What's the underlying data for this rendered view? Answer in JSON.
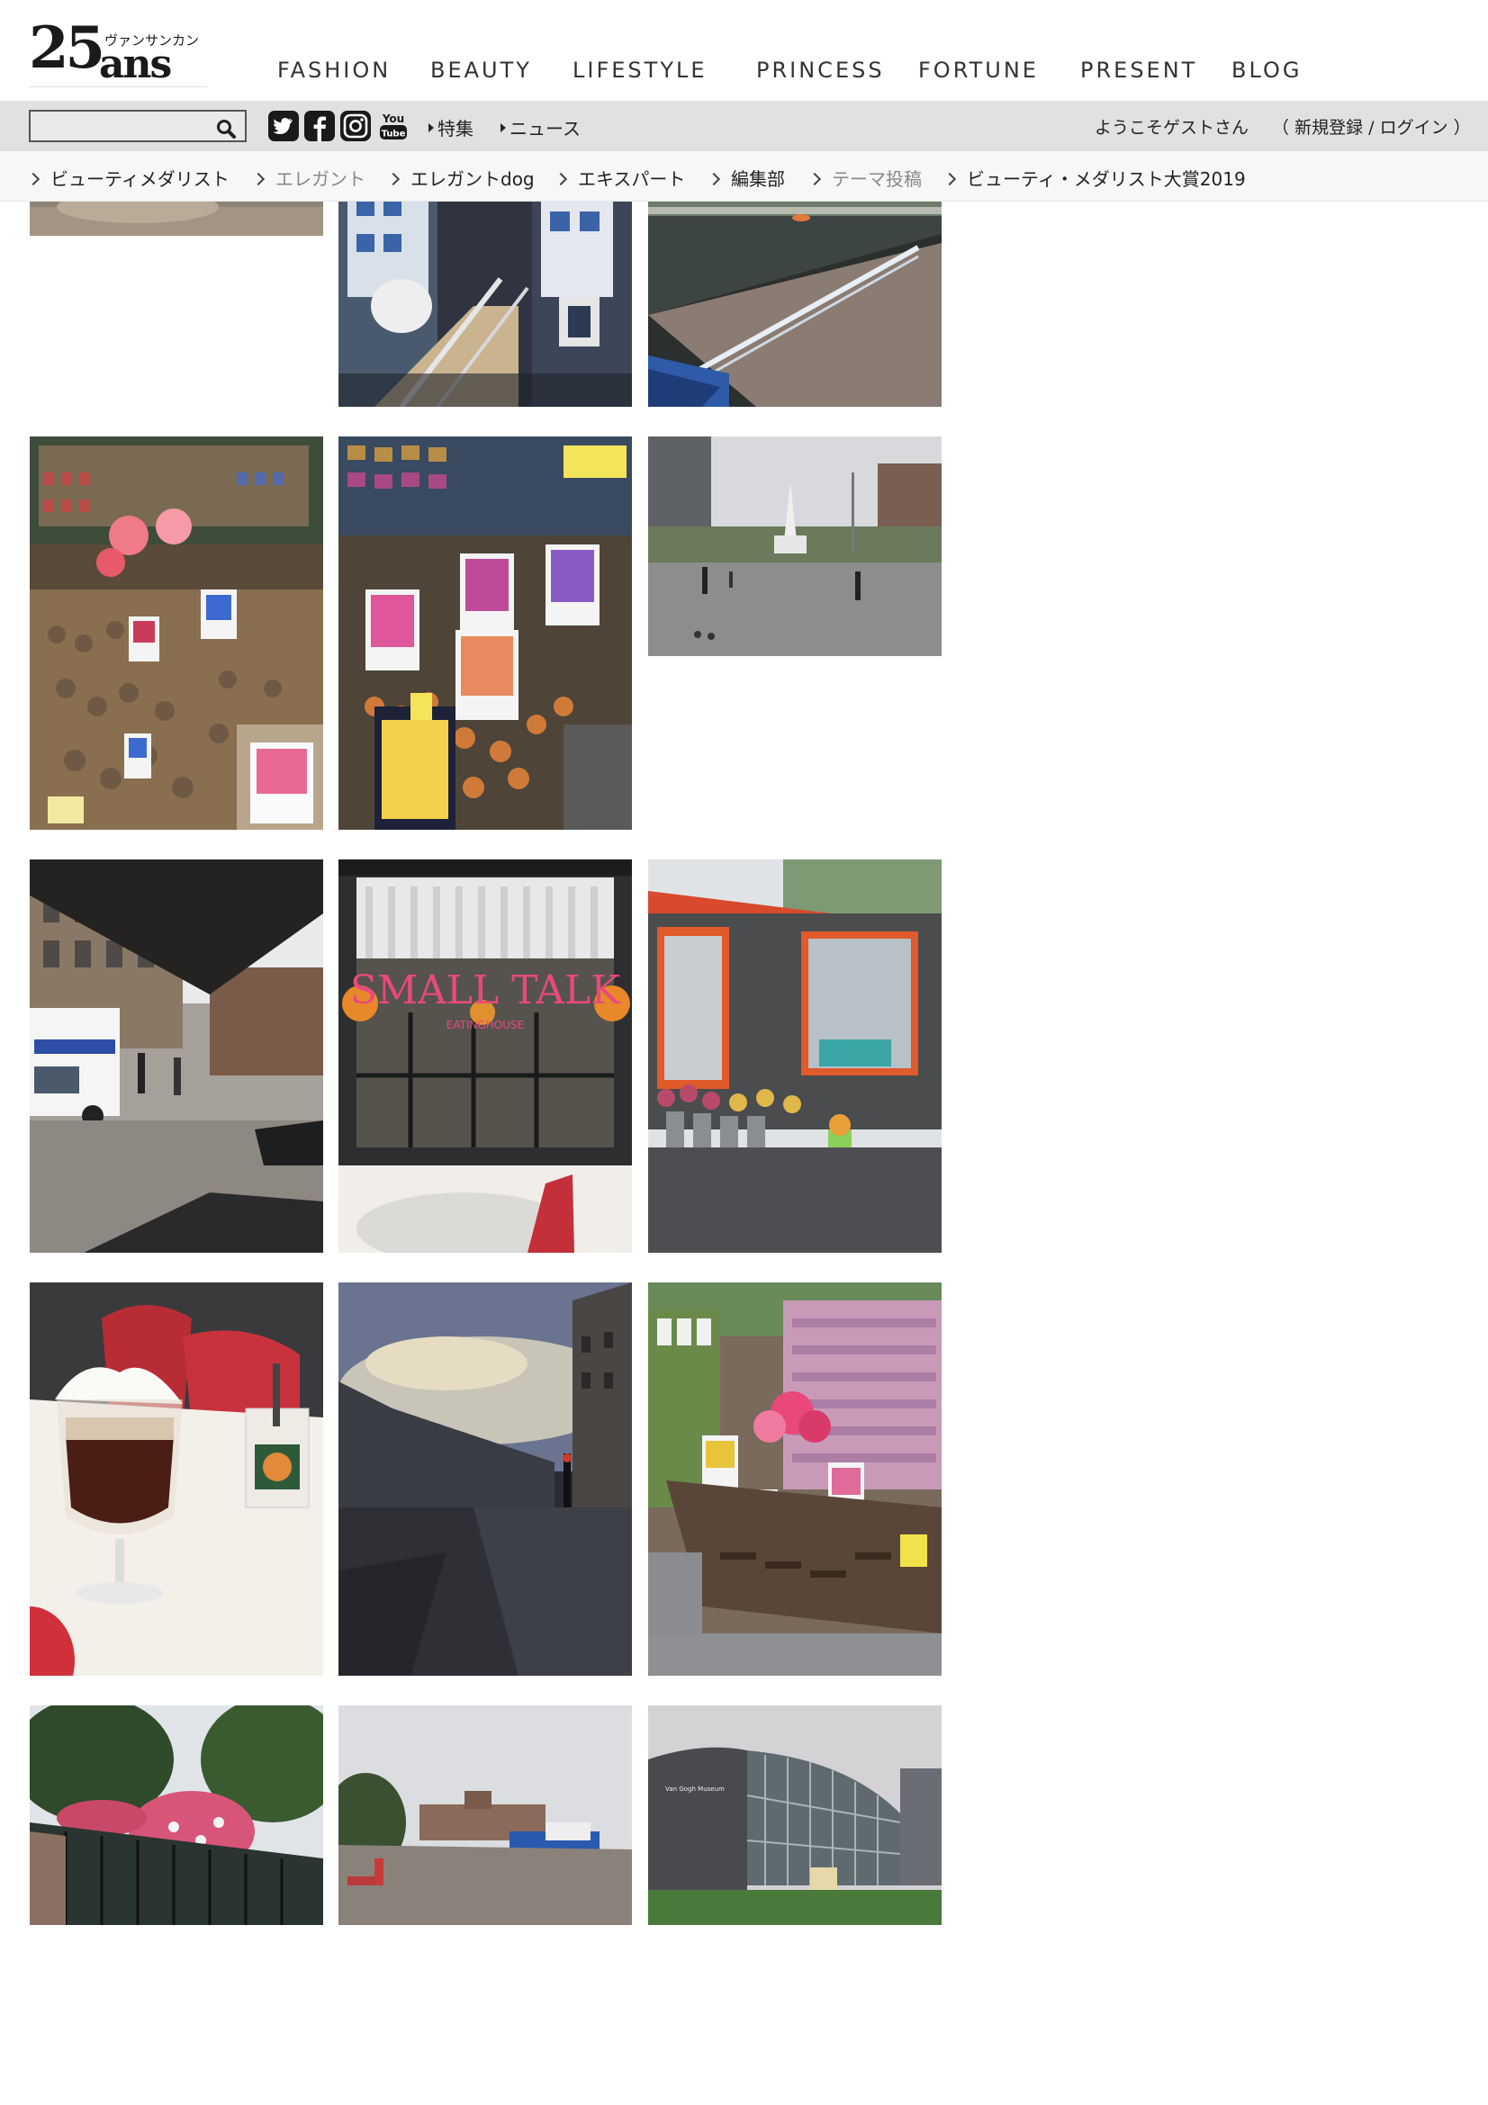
{
  "logo": {
    "number": "25",
    "word": "ans",
    "kana": "ヴァンサンカン"
  },
  "nav": [
    "FASHION",
    "BEAUTY",
    "LIFESTYLE",
    "PRINCESS",
    "FORTUNE",
    "PRESENT",
    "BLOG"
  ],
  "search": {
    "placeholder": "",
    "value": ""
  },
  "social": [
    "twitter-icon",
    "facebook-icon",
    "instagram-icon",
    "youtube-icon"
  ],
  "youtube_label": {
    "top": "You",
    "bottom": "Tube"
  },
  "bar_links": [
    "特集",
    "ニュース"
  ],
  "user": {
    "welcome": "ようこそゲストさん",
    "open": "（",
    "register": "新規登録",
    "sep": "/",
    "login": "ログイン",
    "close": "）"
  },
  "categories": [
    {
      "label": "ビューティメダリスト",
      "muted": false
    },
    {
      "label": "エレガント",
      "muted": true
    },
    {
      "label": "エレガントdog",
      "muted": false
    },
    {
      "label": "エキスパート",
      "muted": false
    },
    {
      "label": "編集部",
      "muted": false
    },
    {
      "label": "テーマ投稿",
      "muted": true
    },
    {
      "label": "ビューティ・メダリスト大賞2019",
      "muted": false
    }
  ],
  "photos": [
    {
      "subject": "top-left-photo-partial"
    },
    {
      "subject": "staircase-delft-shop"
    },
    {
      "subject": "canal-boat"
    },
    {
      "subject": "flower-market-bulbs-1"
    },
    {
      "subject": "flower-market-tulip-bulbs"
    },
    {
      "subject": "dam-square-monument"
    },
    {
      "subject": "street-police-van"
    },
    {
      "subject": "cafe-window",
      "sign": "SMALL TALK",
      "subsign": "EATINGHOUSE"
    },
    {
      "subject": "flower-kiosk"
    },
    {
      "subject": "irish-coffee"
    },
    {
      "subject": "wet-street-dusk"
    },
    {
      "subject": "flower-market-dahlia"
    },
    {
      "subject": "bridge-flowers"
    },
    {
      "subject": "museumplein"
    },
    {
      "subject": "van-gogh-museum",
      "sign": "Van Gogh Museum"
    }
  ],
  "colors": {
    "bar_bg": "#e1e1e1",
    "cat_bg": "#f7f7f7",
    "muted": "#888888",
    "text": "#222222"
  }
}
